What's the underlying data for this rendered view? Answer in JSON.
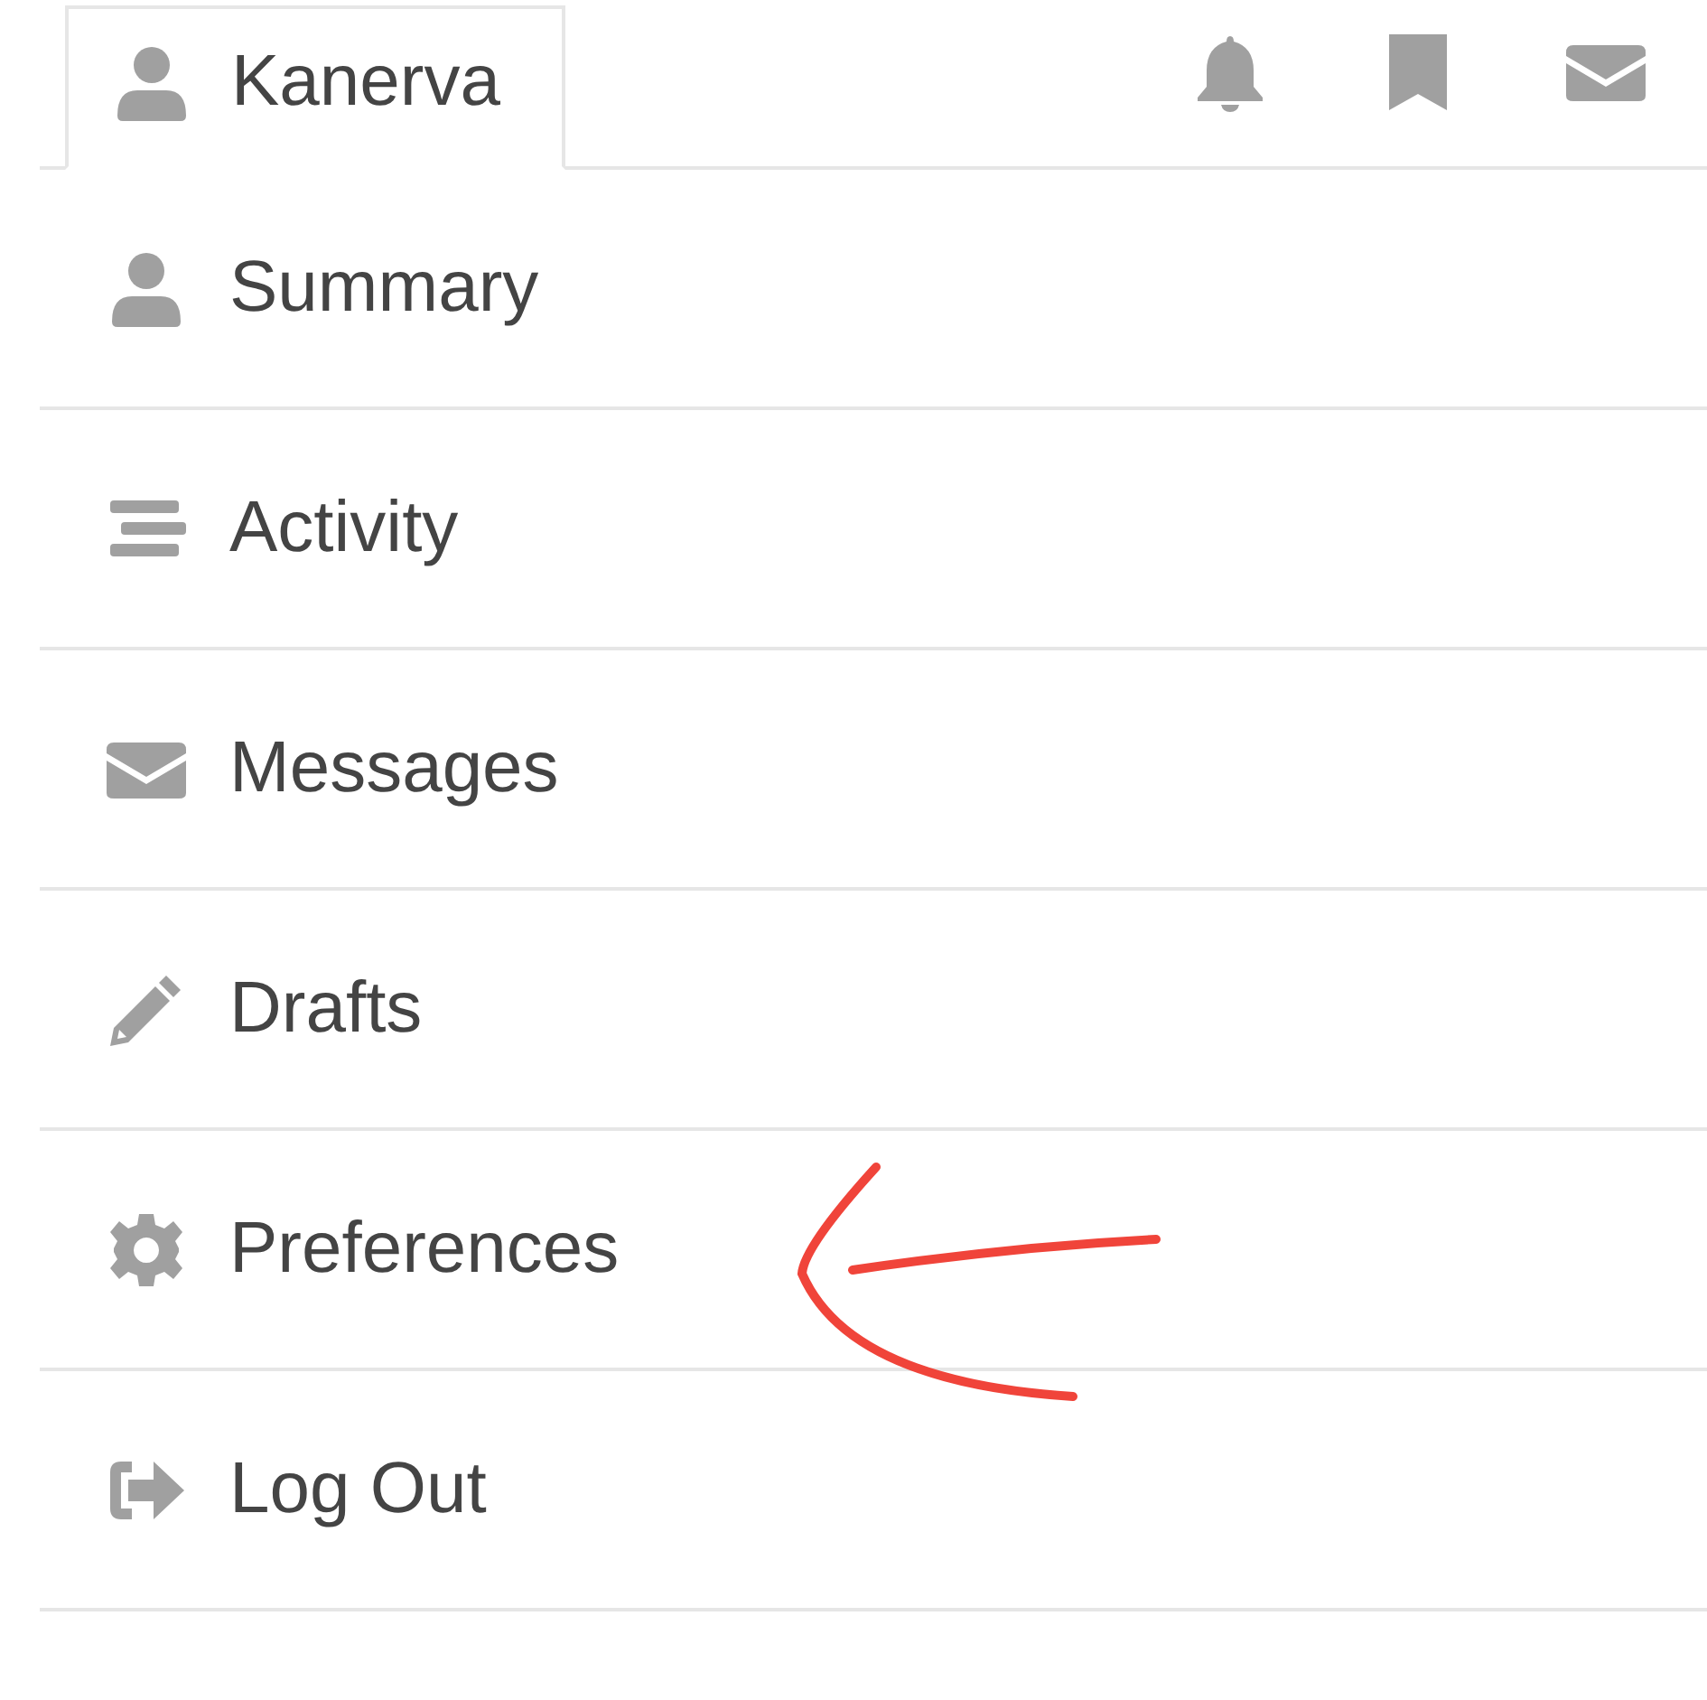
{
  "header": {
    "user_tab": {
      "label": "Kanerva",
      "selected": true
    }
  },
  "menu": [
    {
      "label": "Summary"
    },
    {
      "label": "Activity"
    },
    {
      "label": "Messages"
    },
    {
      "label": "Drafts"
    },
    {
      "label": "Preferences"
    },
    {
      "label": "Log Out"
    }
  ]
}
